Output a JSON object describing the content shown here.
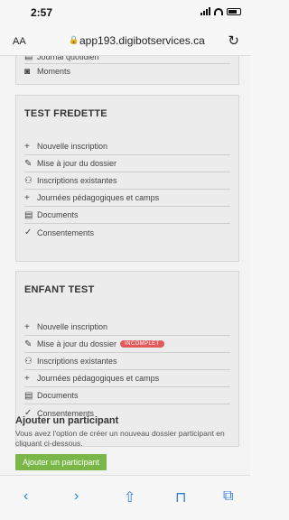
{
  "status_bar": {
    "time": "2:57"
  },
  "browser": {
    "aa": "AA",
    "url": "app193.digibotservices.ca"
  },
  "top_card": {
    "items": [
      {
        "icon": "journal-icon",
        "glyph": "▤",
        "label": "Journal quotidien"
      },
      {
        "icon": "camera-icon",
        "glyph": "◙",
        "label": "Moments"
      }
    ]
  },
  "child_cards": [
    {
      "title": "TEST FREDETTE",
      "items": [
        {
          "icon": "plus-icon",
          "glyph": "+",
          "label": "Nouvelle inscription"
        },
        {
          "icon": "pencil-icon",
          "glyph": "✎",
          "label": "Mise à jour du dossier"
        },
        {
          "icon": "users-icon",
          "glyph": "⚇",
          "label": "Inscriptions existantes"
        },
        {
          "icon": "plus-icon",
          "glyph": "+",
          "label": "Journées pédagogiques et camps"
        },
        {
          "icon": "document-icon",
          "glyph": "▤",
          "label": "Documents"
        },
        {
          "icon": "check-icon",
          "glyph": "✓",
          "label": "Consentements"
        }
      ]
    },
    {
      "title": "ENFANT TEST",
      "badge": "INCOMPLET",
      "items": [
        {
          "icon": "plus-icon",
          "glyph": "+",
          "label": "Nouvelle inscription"
        },
        {
          "icon": "pencil-icon",
          "glyph": "✎",
          "label": "Mise à jour du dossier"
        },
        {
          "icon": "users-icon",
          "glyph": "⚇",
          "label": "Inscriptions existantes"
        },
        {
          "icon": "plus-icon",
          "glyph": "+",
          "label": "Journées pédagogiques et camps"
        },
        {
          "icon": "document-icon",
          "glyph": "▤",
          "label": "Documents"
        },
        {
          "icon": "check-icon",
          "glyph": "✓",
          "label": "Consentements"
        }
      ]
    }
  ],
  "add_participant": {
    "title": "Ajouter un participant",
    "description": "Vous avez l'option de créer un nouveau dossier participant en cliquant ci-dessous.",
    "button": "Ajouter un participant"
  },
  "colors": {
    "accent_green": "#7ab648",
    "badge_red": "#e25a5a",
    "chat_blue": "#3d86d4",
    "ios_blue": "#2f7de0"
  },
  "toolbar": {
    "back": "‹",
    "forward": "›",
    "share": "⇧",
    "bookmarks": "⊓",
    "tabs": "⧉"
  }
}
